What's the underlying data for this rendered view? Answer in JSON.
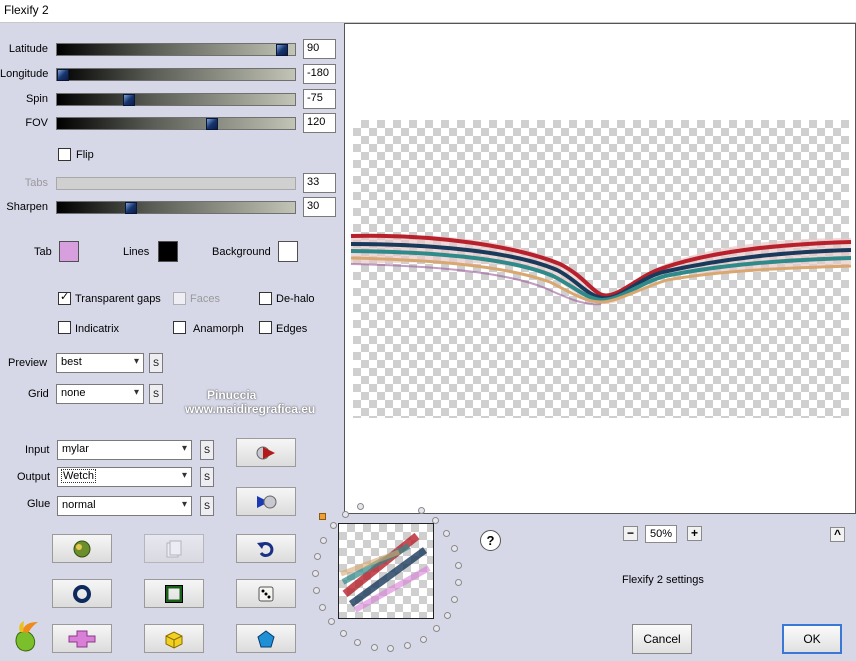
{
  "window": {
    "title": "Flexify 2"
  },
  "sliders": [
    {
      "label": "Latitude",
      "value": "90",
      "fraction": 0.97,
      "enabled": true
    },
    {
      "label": "Longitude",
      "value": "-180",
      "fraction": 0.0,
      "enabled": true
    },
    {
      "label": "Spin",
      "value": "-75",
      "fraction": 0.29,
      "enabled": true
    },
    {
      "label": "FOV",
      "value": "120",
      "fraction": 0.66,
      "enabled": true
    },
    {
      "label": "Tabs",
      "value": "33",
      "fraction": 0.0,
      "enabled": false
    },
    {
      "label": "Sharpen",
      "value": "30",
      "fraction": 0.3,
      "enabled": true
    }
  ],
  "flip": {
    "label": "Flip",
    "checked": false
  },
  "colors": {
    "tab": {
      "label": "Tab",
      "color": "#d79fdd"
    },
    "lines": {
      "label": "Lines",
      "color": "#000000"
    },
    "background": {
      "label": "Background",
      "color": "#ffffff"
    }
  },
  "options": {
    "transparent_gaps": {
      "label": "Transparent gaps",
      "checked": true
    },
    "faces": {
      "label": "Faces",
      "checked": false,
      "enabled": false
    },
    "de_halo": {
      "label": "De-halo",
      "checked": false
    },
    "indicatrix": {
      "label": "Indicatrix",
      "checked": false
    },
    "anamorph": {
      "label": "Anamorph",
      "checked": false
    },
    "edges": {
      "label": "Edges",
      "checked": false
    }
  },
  "selects": {
    "preview": {
      "label": "Preview",
      "value": "best"
    },
    "grid": {
      "label": "Grid",
      "value": "none"
    },
    "input": {
      "label": "Input",
      "value": "mylar"
    },
    "output": {
      "label": "Output",
      "value": "Wetch"
    },
    "glue": {
      "label": "Glue",
      "value": "normal"
    }
  },
  "s_label": "S",
  "watermark": {
    "line1": "Pinuccia",
    "line2": "www.maidiregrafica.eu"
  },
  "zoom": {
    "value": "50%",
    "minus": "−",
    "plus": "+"
  },
  "collapse_label": "^",
  "help_label": "?",
  "settings_label": "Flexify 2 settings",
  "buttons": {
    "cancel": "Cancel",
    "ok": "OK"
  }
}
